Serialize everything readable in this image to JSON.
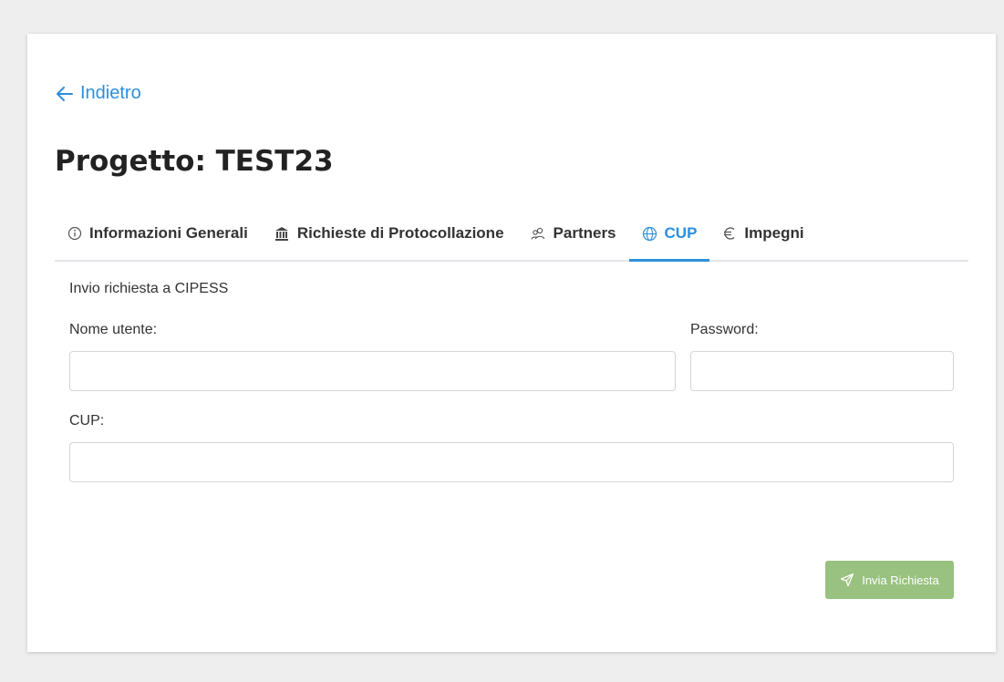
{
  "navigation": {
    "back_label": "Indietro"
  },
  "project": {
    "title": "Progetto: TEST23"
  },
  "tabs": [
    {
      "label": "Informazioni Generali",
      "icon": "info-circle-icon"
    },
    {
      "label": "Richieste di Protocollazione",
      "icon": "bank-icon"
    },
    {
      "label": "Partners",
      "icon": "users-icon"
    },
    {
      "label": "CUP",
      "icon": "globe-icon",
      "active": true
    },
    {
      "label": "Impegni",
      "icon": "euro-icon"
    }
  ],
  "form": {
    "section_title": "Invio richiesta a CIPESS",
    "username_label": "Nome utente:",
    "username_value": "",
    "password_label": "Password:",
    "password_value": "",
    "cup_label": "CUP:",
    "cup_value": "",
    "submit_label": "Invia Richiesta",
    "submit_icon": "send-icon"
  },
  "colors": {
    "accent": "#2d8fdc",
    "submit_button": "#99c17f",
    "background": "#eeeeee"
  }
}
